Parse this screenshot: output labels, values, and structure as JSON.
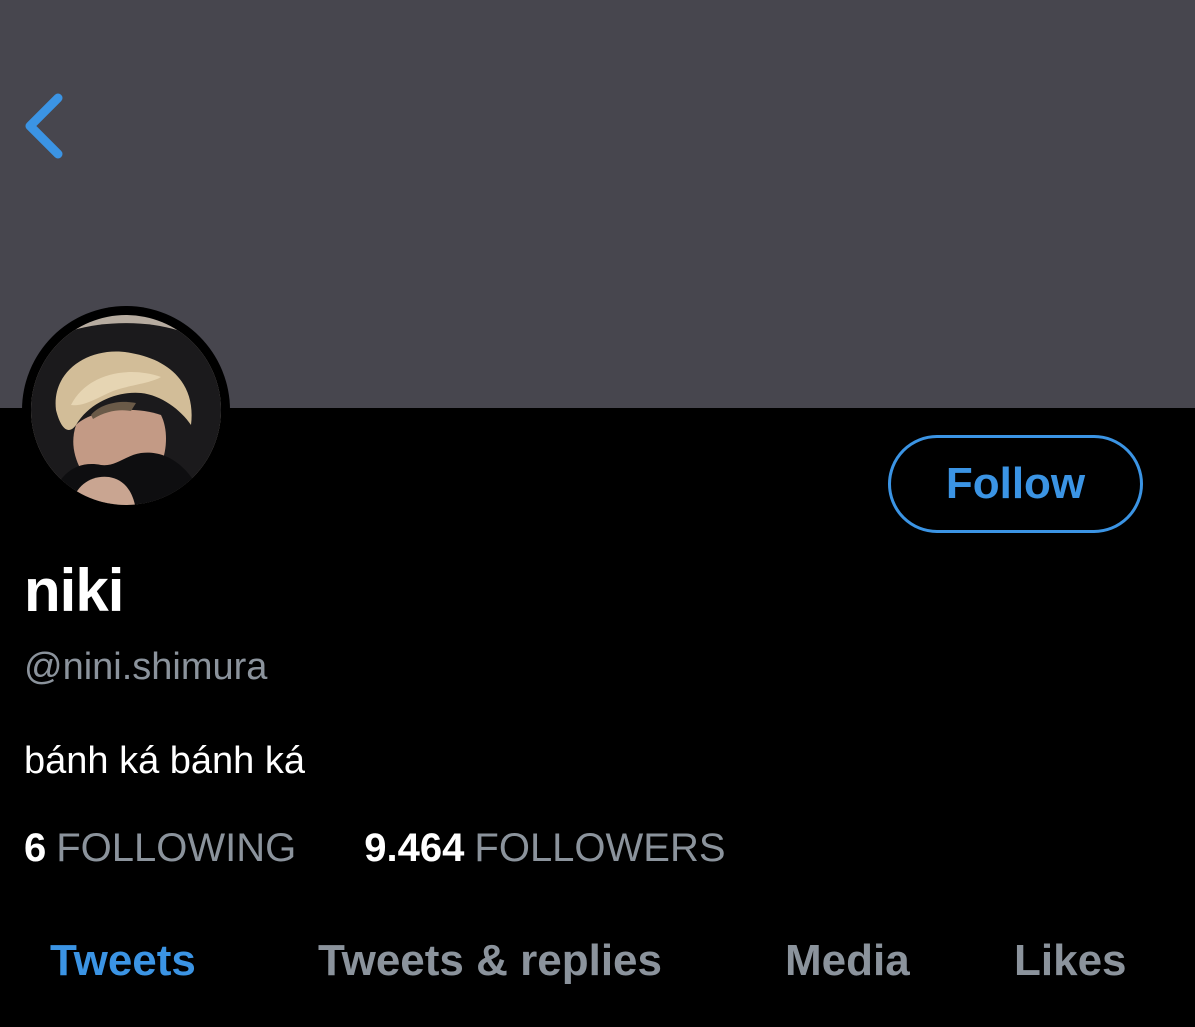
{
  "header": {
    "back_icon": "chevron-left-icon",
    "banner_color": "#47464e"
  },
  "profile": {
    "display_name": "niki",
    "handle": "@nini.shimura",
    "bio": "bánh ká bánh ká",
    "follow_label": "Follow",
    "accent_color": "#3b94e4"
  },
  "stats": {
    "following_count": "6",
    "following_label": "FOLLOWING",
    "followers_count": "9.464",
    "followers_label": "FOLLOWERS"
  },
  "tabs": [
    {
      "label": "Tweets",
      "active": true
    },
    {
      "label": "Tweets & replies",
      "active": false
    },
    {
      "label": "Media",
      "active": false
    },
    {
      "label": "Likes",
      "active": false
    }
  ]
}
